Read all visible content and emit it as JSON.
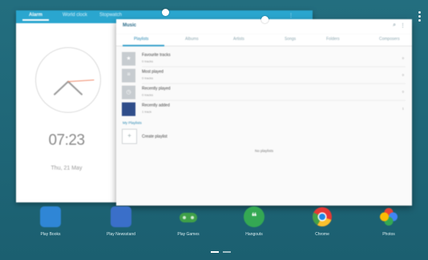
{
  "clock_app": {
    "tabs": [
      "Alarm",
      "World clock",
      "Stopwatch"
    ],
    "time": "07:23",
    "date": "Thu, 21 May"
  },
  "music_app": {
    "title": "Music",
    "tabs": [
      "Playlists",
      "Albums",
      "Artists",
      "Songs",
      "Folders",
      "Composers"
    ],
    "playlists": [
      {
        "title": "Favourite tracks",
        "subtitle": "0 tracks",
        "count": "0",
        "thumb": "star"
      },
      {
        "title": "Most played",
        "subtitle": "0 tracks",
        "count": "0",
        "thumb": "list"
      },
      {
        "title": "Recently played",
        "subtitle": "0 tracks",
        "count": "0",
        "thumb": "clock"
      },
      {
        "title": "Recently added",
        "subtitle": "1 track",
        "count": "1",
        "thumb": "album"
      }
    ],
    "my_playlists_label": "My Playlists",
    "create_label": "Create playlist",
    "empty_note": "No playlists"
  },
  "dock": [
    {
      "label": "Play Books",
      "icon": "play-books-icon",
      "color": "#2f86d6"
    },
    {
      "label": "Play Newsstand",
      "icon": "play-newsstand-icon",
      "color": "#3a6fc9"
    },
    {
      "label": "Play Games",
      "icon": "play-games-icon",
      "color": "#3fa048"
    },
    {
      "label": "Hangouts",
      "icon": "hangouts-icon",
      "color": "#34a853"
    },
    {
      "label": "Chrome",
      "icon": "chrome-icon",
      "color": "#e53935"
    },
    {
      "label": "Photos",
      "icon": "photos-icon",
      "color": "#fbbc05"
    }
  ],
  "colors": {
    "wallpaper": "#1f6a7a",
    "clock_bar": "#2aa6cf",
    "music_accent": "#2a89b3"
  }
}
